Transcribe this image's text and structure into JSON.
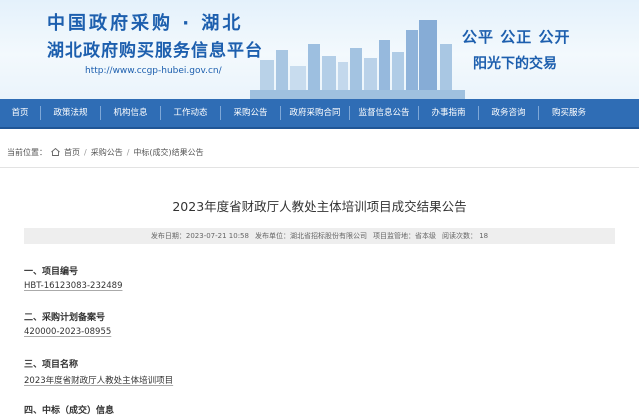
{
  "header": {
    "title_line1": "中国政府采购 · 湖北",
    "title_line2": "湖北政府购买服务信息平台",
    "url": "http://www.ccgp-hubei.gov.cn/",
    "slogan_line1": "公平  公正  公开",
    "slogan_line2": "阳光下的交易"
  },
  "nav": {
    "items": [
      {
        "label": "首页"
      },
      {
        "label": "政策法规"
      },
      {
        "label": "机构信息"
      },
      {
        "label": "工作动态"
      },
      {
        "label": "采购公告"
      },
      {
        "label": "政府采购合同"
      },
      {
        "label": "监督信息公告"
      },
      {
        "label": "办事指南"
      },
      {
        "label": "政务咨询"
      },
      {
        "label": "购买服务"
      }
    ]
  },
  "breadcrumb": {
    "label": "当前位置：",
    "items": [
      "首页",
      "采购公告",
      "中标(成交)结果公告"
    ],
    "separator": "/"
  },
  "article": {
    "title": "2023年度省财政厅人教处主体培训项目成交结果公告",
    "meta": {
      "publish_date": "发布日期：2023-07-21 10:58",
      "publisher": "发布单位：湖北省招标股份有限公司",
      "supervisor": "项目监管地：省本级",
      "views": "阅读次数：  18"
    },
    "sections": [
      {
        "heading": "一、项目编号",
        "value": "HBT-16123083-232489"
      },
      {
        "heading": "二、采购计划备案号",
        "value": "420000-2023-08955"
      },
      {
        "heading": "三、项目名称",
        "value": "2023年度省财政厅人教处主体培训项目"
      },
      {
        "heading": "四、中标（成交）信息",
        "value": ""
      }
    ]
  },
  "colors": {
    "nav_bg": "#2f6db5",
    "brand_blue": "#1d5fae",
    "meta_bg": "#eeeeee"
  }
}
